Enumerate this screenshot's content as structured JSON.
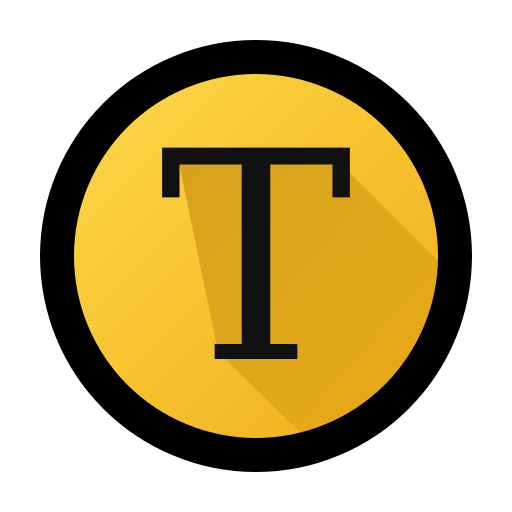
{
  "icon": {
    "letter": "T",
    "name": "letter-t-app-icon",
    "colors": {
      "ring": "#000000",
      "fill_light": "#FFD23F",
      "fill_dark": "#F0B020",
      "shadow": "#C98A00",
      "letter": "#111111",
      "background": "#FFFFFF"
    }
  }
}
